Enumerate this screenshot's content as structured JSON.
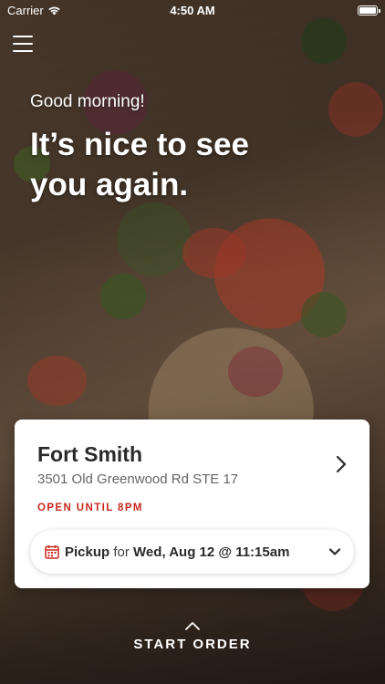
{
  "status_bar": {
    "carrier": "Carrier",
    "time": "4:50 AM",
    "wifi_icon": "wifi-icon",
    "battery_icon": "battery-icon"
  },
  "header": {
    "menu_icon": "hamburger-menu-icon"
  },
  "greeting": {
    "salutation": "Good morning!",
    "headline": "It’s nice to see you again."
  },
  "location_card": {
    "store_name": "Fort Smith",
    "address": "3501 Old Greenwood Rd STE 17",
    "hours": "OPEN UNTIL 8PM",
    "chevron_icon": "chevron-right-icon",
    "pickup": {
      "icon": "calendar-icon",
      "mode": "Pickup",
      "for_word": "for",
      "datetime": "Wed, Aug 12 @ 11:15am",
      "dropdown_icon": "chevron-down-icon"
    }
  },
  "footer": {
    "up_icon": "chevron-up-icon",
    "start_order_label": "START ORDER"
  },
  "colors": {
    "accent_red": "#c8281e",
    "card_bg": "#ffffff",
    "text_dark": "#2a2a2a",
    "text_muted": "#666666"
  }
}
